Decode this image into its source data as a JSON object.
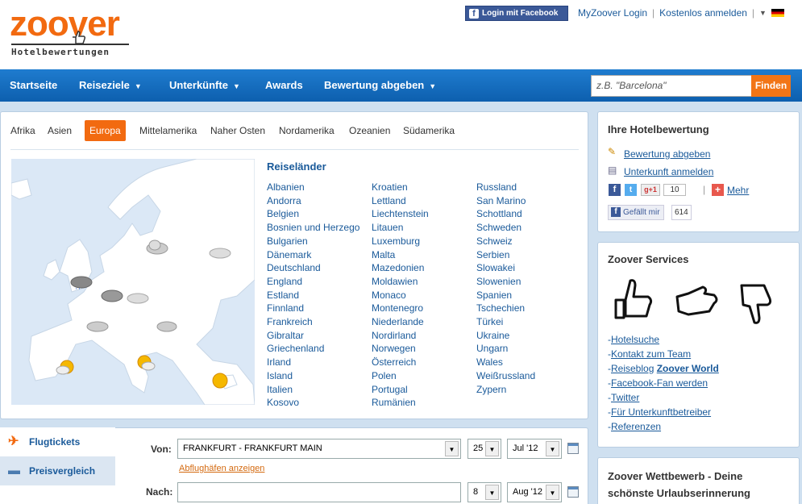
{
  "header": {
    "logo_text": "zoover",
    "logo_subtitle": "Hotelbewertungen",
    "fb_login": "Login mit Facebook",
    "myzoover": "MyZoover Login",
    "register": "Kostenlos anmelden"
  },
  "nav": {
    "items": [
      "Startseite",
      "Reiseziele",
      "Unterkünfte",
      "Awards",
      "Bewertung abgeben"
    ],
    "search_placeholder": "z.B. \"Barcelona\"",
    "search_button": "Finden"
  },
  "regions": [
    "Afrika",
    "Asien",
    "Europa",
    "Mittelamerika",
    "Naher Osten",
    "Nordamerika",
    "Ozeanien",
    "Südamerika"
  ],
  "countries_title": "Reiseländer",
  "countries": {
    "col1": [
      "Albanien",
      "Andorra",
      "Belgien",
      "Bosnien und Herzego",
      "Bulgarien",
      "Dänemark",
      "Deutschland",
      "England",
      "Estland",
      "Finnland",
      "Frankreich",
      "Gibraltar",
      "Griechenland",
      "Irland",
      "Island",
      "Italien",
      "Kosovo"
    ],
    "col2": [
      "Kroatien",
      "Lettland",
      "Liechtenstein",
      "Litauen",
      "Luxemburg",
      "Malta",
      "Mazedonien",
      "Moldawien",
      "Monaco",
      "Montenegro",
      "Niederlande",
      "Nordirland",
      "Norwegen",
      "Österreich",
      "Polen",
      "Portugal",
      "Rumänien"
    ],
    "col3": [
      "Russland",
      "San Marino",
      "Schottland",
      "Schweden",
      "Schweiz",
      "Serbien",
      "Slowakei",
      "Slowenien",
      "Spanien",
      "Tschechien",
      "Türkei",
      "Ukraine",
      "Ungarn",
      "Wales",
      "Weißrussland",
      "Zypern"
    ]
  },
  "sidebar": {
    "review_title": "Ihre Hotelbewertung",
    "write_review": "Bewertung abgeben",
    "register_property": "Unterkunft anmelden",
    "gplus_count": "10",
    "more": "Mehr",
    "like_label": "Gefällt mir",
    "like_count": "614",
    "services_title": "Zoover Services",
    "services": [
      "Hotelsuche",
      "Kontakt zum Team",
      "Reiseblog",
      "Facebook-Fan werden",
      "Twitter",
      "Für Unterkunftbetreiber",
      "Referenzen"
    ],
    "blog_bold": "Zoover World",
    "contest_title": "Zoover Wettbewerb - Deine schönste Urlaubserinnerung"
  },
  "flight": {
    "tab_flights": "Flugtickets",
    "tab_compare": "Preisvergleich",
    "from_label": "Von:",
    "from_value": "FRANKFURT - FRANKFURT MAIN",
    "show_airports": "Abflughäfen anzeigen",
    "to_label": "Nach:",
    "from_day": "25",
    "from_month": "Jul '12",
    "to_day": "8",
    "to_month": "Aug '12"
  }
}
